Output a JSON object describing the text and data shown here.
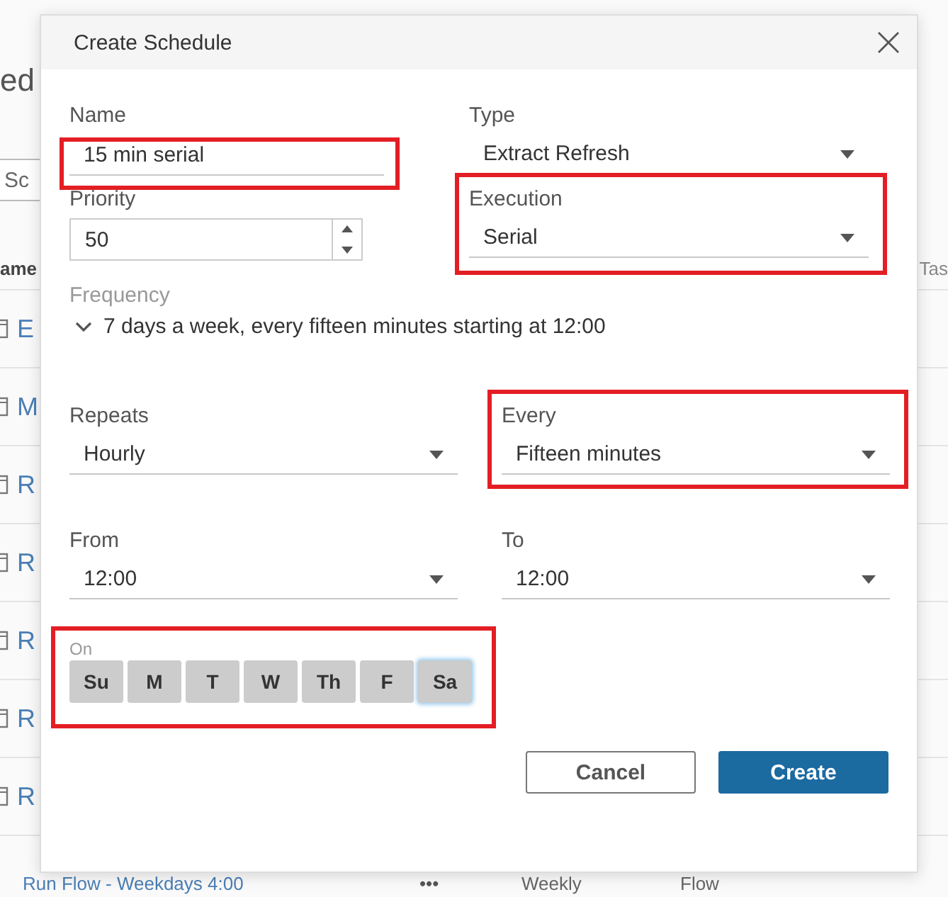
{
  "background_page": {
    "heading": "ed",
    "search": {
      "placeholder": "Sc"
    },
    "columns": [
      "ame",
      "Tas"
    ],
    "rows": [
      {
        "name": "E"
      },
      {
        "name": "M"
      },
      {
        "name": "R"
      },
      {
        "name": "R"
      },
      {
        "name": "R"
      },
      {
        "name": "R"
      },
      {
        "name": "R"
      }
    ],
    "partial_row": {
      "name": "Run Flow - Weekdays 4:00",
      "actions": "•••",
      "frequency": "Weekly",
      "type": "Flow"
    }
  },
  "dialog": {
    "title": "Create Schedule",
    "top_fields": [
      {
        "kind": "text",
        "label": "Name",
        "value": "15 min serial",
        "highlighted": true
      },
      {
        "kind": "dropdown",
        "label": "Type",
        "value": "Extract Refresh",
        "highlighted": false
      },
      {
        "kind": "number",
        "label": "Priority",
        "value": "50",
        "highlighted": false
      },
      {
        "kind": "dropdown",
        "label": "Execution",
        "value": "Serial",
        "highlighted": true
      }
    ],
    "frequency": {
      "label": "Frequency",
      "summary": "7 days a week, every fifteen minutes starting at 12:00"
    },
    "recurrence_fields": [
      {
        "kind": "dropdown",
        "label": "Repeats",
        "value": "Hourly",
        "highlighted": false
      },
      {
        "kind": "dropdown",
        "label": "Every",
        "value": "Fifteen minutes",
        "highlighted": true
      },
      {
        "kind": "dropdown",
        "label": "From",
        "value": "12:00",
        "highlighted": false
      },
      {
        "kind": "dropdown",
        "label": "To",
        "value": "12:00",
        "highlighted": false
      }
    ],
    "days": {
      "label": "On",
      "highlighted": true,
      "items": [
        {
          "label": "Su",
          "selected": true,
          "focused": false
        },
        {
          "label": "M",
          "selected": true,
          "focused": false
        },
        {
          "label": "T",
          "selected": true,
          "focused": false
        },
        {
          "label": "W",
          "selected": true,
          "focused": false
        },
        {
          "label": "Th",
          "selected": true,
          "focused": false
        },
        {
          "label": "F",
          "selected": true,
          "focused": false
        },
        {
          "label": "Sa",
          "selected": true,
          "focused": true
        }
      ]
    },
    "buttons": [
      {
        "kind": "secondary",
        "label": "Cancel"
      },
      {
        "kind": "primary",
        "label": "Create"
      }
    ]
  }
}
